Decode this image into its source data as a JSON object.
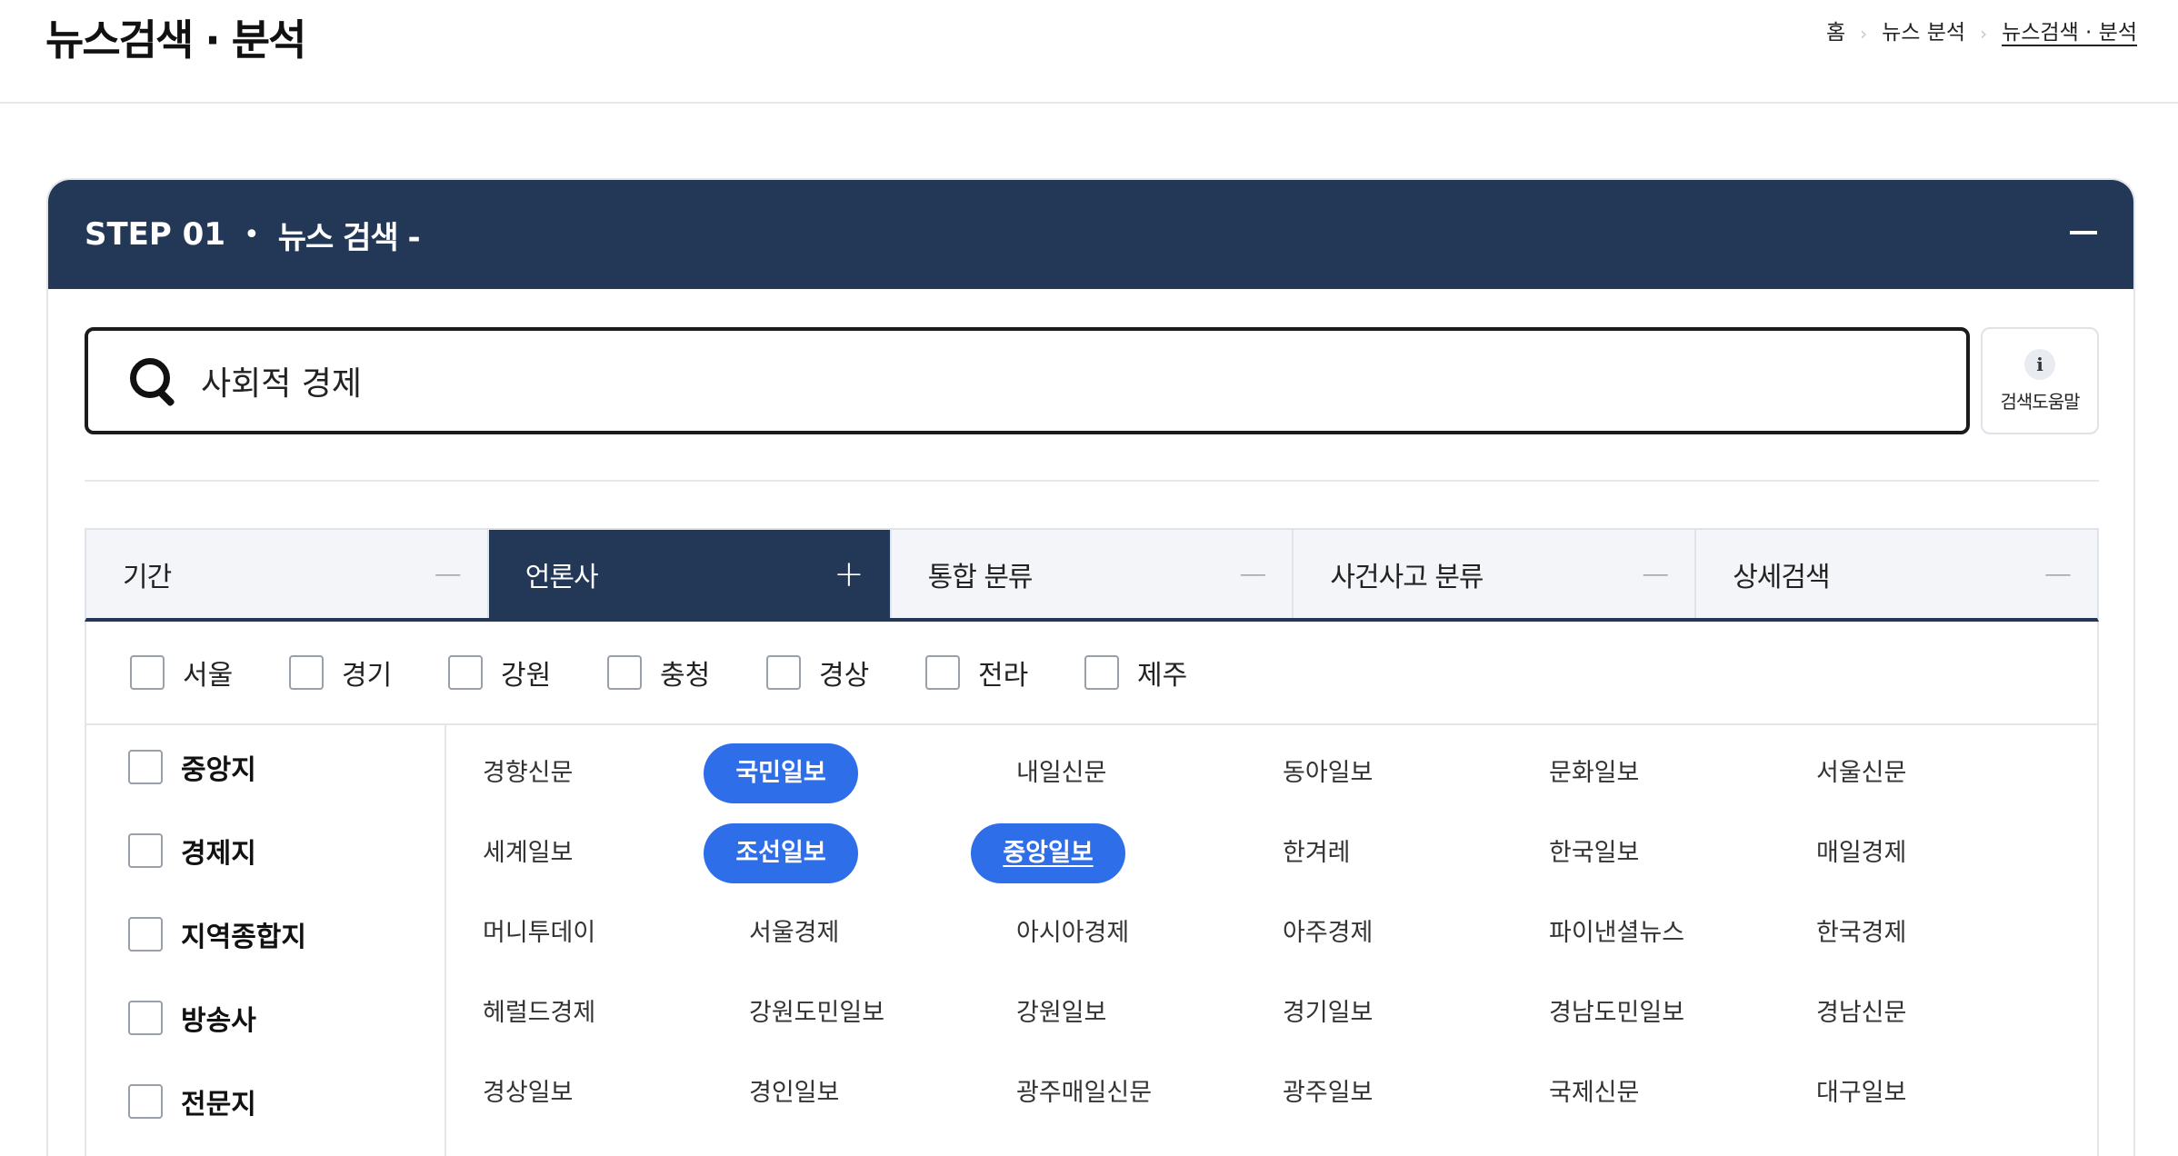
{
  "header": {
    "title": "뉴스검색 · 분석",
    "breadcrumb": [
      "홈",
      "뉴스 분석",
      "뉴스검색 · 분석"
    ],
    "breadcrumb_separator": "›"
  },
  "step": {
    "label": "STEP 01",
    "dot": "•",
    "title": "뉴스 검색 -",
    "collapse_icon": "minus-icon"
  },
  "search": {
    "value": "사회적 경제",
    "icon": "search-icon",
    "help_icon_glyph": "i",
    "help_label": "검색도움말"
  },
  "tabs": [
    {
      "label": "기간",
      "sign": "—",
      "active": false
    },
    {
      "label": "언론사",
      "sign": "+",
      "active": true
    },
    {
      "label": "통합 분류",
      "sign": "—",
      "active": false
    },
    {
      "label": "사건사고 분류",
      "sign": "—",
      "active": false
    },
    {
      "label": "상세검색",
      "sign": "—",
      "active": false
    }
  ],
  "regions": [
    "서울",
    "경기",
    "강원",
    "충청",
    "경상",
    "전라",
    "제주"
  ],
  "categories": [
    "중앙지",
    "경제지",
    "지역종합지",
    "방송사",
    "전문지"
  ],
  "papers": [
    [
      "경향신문",
      "국민일보",
      "내일신문",
      "동아일보",
      "문화일보",
      "서울신문"
    ],
    [
      "세계일보",
      "조선일보",
      "중앙일보",
      "한겨레",
      "한국일보",
      "매일경제"
    ],
    [
      "머니투데이",
      "서울경제",
      "아시아경제",
      "아주경제",
      "파이낸셜뉴스",
      "한국경제"
    ],
    [
      "헤럴드경제",
      "강원도민일보",
      "강원일보",
      "경기일보",
      "경남도민일보",
      "경남신문"
    ],
    [
      "경상일보",
      "경인일보",
      "광주매일신문",
      "광주일보",
      "국제신문",
      "대구일보"
    ]
  ],
  "selected_papers": [
    "국민일보",
    "조선일보",
    "중앙일보"
  ],
  "colors": {
    "navy": "#233757",
    "selected_pill": "#2e6ee8",
    "tab_bg": "#f3f5f9"
  }
}
